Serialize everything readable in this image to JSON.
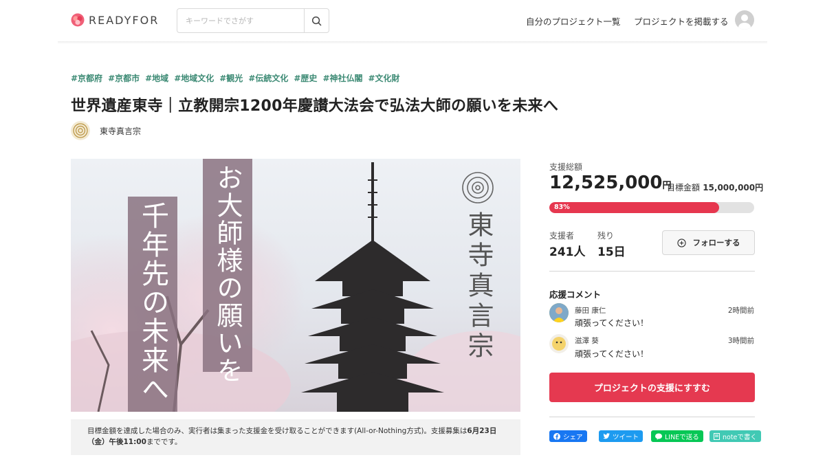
{
  "header": {
    "logo_text": "READYFOR",
    "search_placeholder": "キーワードでさがす",
    "nav": [
      "自分のプロジェクト一覧",
      "プロジェクトを掲載する"
    ]
  },
  "project": {
    "tags": [
      "#京都府",
      "#京都市",
      "#地域",
      "#地域文化",
      "#観光",
      "#伝統文化",
      "#歴史",
      "#神社仏閣",
      "#文化財"
    ],
    "title": "世界遺産東寺｜立教開宗1200年慶讃大法会で弘法大師の願いを未来へ",
    "owner": "東寺真言宗"
  },
  "hero": {
    "banner_top": "お大師様の願いを",
    "banner_bottom": "千年先の未来へ",
    "temple_name": "東寺真言宗"
  },
  "notice": {
    "text": "目標金額を達成した場合のみ、実行者は集まった支援金を受け取ることができます(All-or-Nothing方式)。支援募集は",
    "date": "6月23日（金）午後11:00",
    "tail": "までです。"
  },
  "funding": {
    "total_label": "支援総額",
    "total": "12,525,000",
    "yen": "円",
    "goal_label": "目標金額",
    "goal": "15,000,000円",
    "percent": 83,
    "percent_label": "83%",
    "supporters_label": "支援者",
    "supporters": "241人",
    "remaining_label": "残り",
    "remaining": "15日",
    "follow_label": "フォローする"
  },
  "comments": {
    "title": "応援コメント",
    "items": [
      {
        "name": "藤田 康仁",
        "time": "2時間前",
        "text": "頑張ってください！"
      },
      {
        "name": "滋澤 葵",
        "time": "3時間前",
        "text": "頑張ってください！"
      }
    ]
  },
  "cta": "プロジェクトの支援にすすむ",
  "share": {
    "facebook": "シェア",
    "twitter": "ツイート",
    "line": "LINEで送る",
    "note": "noteで書く"
  },
  "colors": {
    "accent": "#e53950",
    "tag": "#3c8a74"
  }
}
